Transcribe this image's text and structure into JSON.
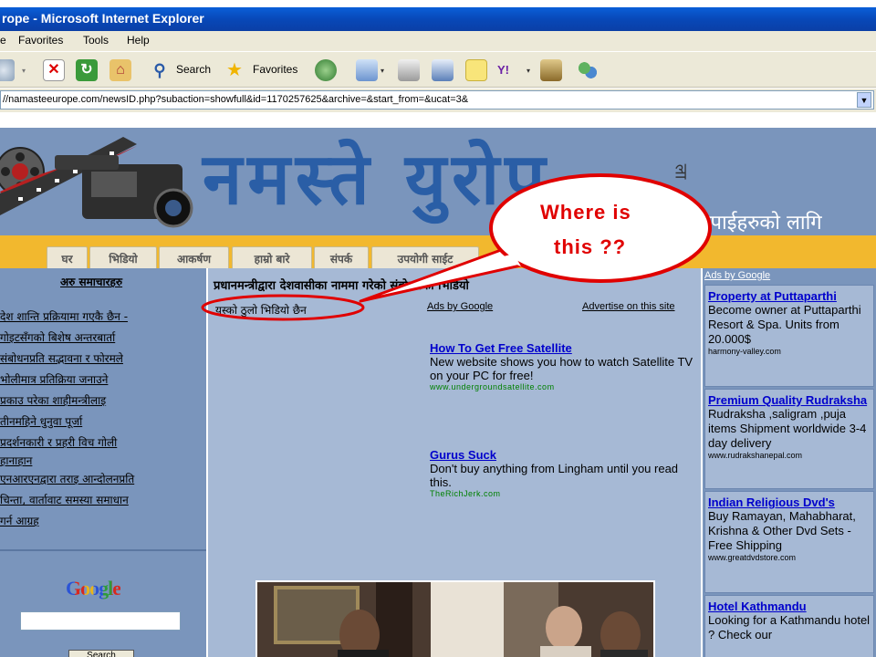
{
  "browser": {
    "title": "rope - Microsoft Internet Explorer",
    "menu": [
      "Favorites",
      "Tools",
      "Help"
    ],
    "toolbar": {
      "search_label": "Search",
      "favorites_label": "Favorites"
    },
    "address": "//namasteeurope.com/newsID.php?subaction=showfull&id=1170257625&archive=&start_from=&ucat=3&"
  },
  "site": {
    "title": "नमस्ते युरोप",
    "side_mark": "ला",
    "subtitle": "तपाईहरुको लागि",
    "nav": [
      "घर",
      "भिडियो",
      "आकर्षण",
      "हाम्रो बारे",
      "संपर्क",
      "उपयोगी साईट"
    ]
  },
  "left": {
    "heading": "अरु समाचारहरु",
    "links": [
      "देश शान्ति प्रक्रियामा गएकै छैन -",
      "गोइटसँगको बिशेष अन्तरबार्ता",
      "संबोधनप्रति सद्भावना र फोरमले",
      "भोलीमात्र प्रतिक्रिया जनाउने",
      "प्रकाउ परेका शाहीमन्त्रीलाइ",
      "तीनमहिने धुनुवा पूर्जा",
      "प्रदर्शनकारी र प्रहरी विच गोली",
      "हानाहान",
      "एनआरएनद्वारा तराइ आन्दोलनप्रति",
      "चिन्ता, वार्तावाट समस्या समाधान",
      "गर्न आग्रह"
    ],
    "google_label": "Google",
    "search_button": "Search"
  },
  "main": {
    "headline": "प्रधानमन्त्रीद्वारा देशवासीका नाममा गरेको संबोधनको भिडियो",
    "video_link": "यस्को ठुलो भिडियो छैन",
    "ads_by_google": "Ads by Google",
    "advertise": "Advertise on this site",
    "ads": [
      {
        "title": "How To Get Free Satellite",
        "desc": "New website shows you how to watch Satellite TV on your PC for free!",
        "url": "www.undergroundsatellite.com"
      },
      {
        "title": "Gurus Suck",
        "desc": "Don't buy anything from Lingham until you read this.",
        "url": "TheRichJerk.com"
      }
    ]
  },
  "right": {
    "ads_by_google": "Ads by Google",
    "ads": [
      {
        "title": "Property at Puttaparthi",
        "desc": "Become owner at Puttaparthi Resort & Spa. Units from 20.000$",
        "url": "harmony-valley.com"
      },
      {
        "title": "Premium Quality Rudraksha",
        "desc": "Rudraksha ,saligram ,puja items Shipment worldwide 3-4 day delivery",
        "url": "www.rudrakshanepal.com"
      },
      {
        "title": "Indian Religious Dvd's",
        "desc": "Buy Ramayan, Mahabharat, Krishna & Other Dvd Sets - Free Shipping",
        "url": "www.greatdvdstore.com"
      },
      {
        "title": "Hotel Kathmandu",
        "desc": "Looking for a Kathmandu hotel ? Check our",
        "url": ""
      }
    ]
  },
  "callout": {
    "line1": "Where is",
    "line2": "this ??"
  },
  "colors": {
    "annotation": "#e00000",
    "header_bg": "#7a95bc",
    "nav_bg": "#f2b82e",
    "link": "#0000cc"
  }
}
